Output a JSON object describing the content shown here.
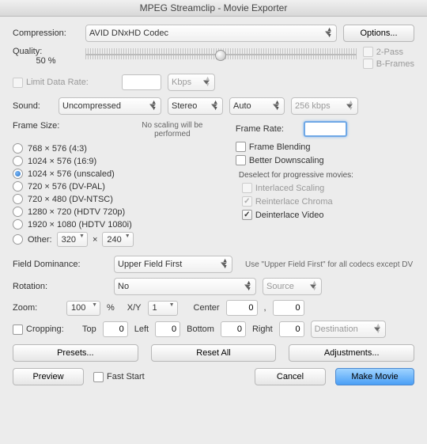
{
  "window": {
    "title": "MPEG Streamclip - Movie Exporter"
  },
  "compression": {
    "label": "Compression:",
    "value": "AVID DNxHD Codec",
    "options_button": "Options..."
  },
  "quality": {
    "label": "Quality:",
    "value_text": "50 %",
    "percent": 50,
    "two_pass": "2-Pass",
    "b_frames": "B-Frames"
  },
  "limit_data_rate": {
    "label": "Limit Data Rate:",
    "value": "",
    "unit": "Kbps"
  },
  "sound": {
    "label": "Sound:",
    "codec": "Uncompressed",
    "channels": "Stereo",
    "rate": "Auto",
    "bitrate": "256 kbps"
  },
  "frame_size": {
    "label": "Frame Size:",
    "note": "No scaling will be performed",
    "options": [
      {
        "label": "768 × 576  (4:3)",
        "checked": false
      },
      {
        "label": "1024 × 576  (16:9)",
        "checked": false
      },
      {
        "label": "1024 × 576  (unscaled)",
        "checked": true
      },
      {
        "label": "720 × 576  (DV-PAL)",
        "checked": false
      },
      {
        "label": "720 × 480  (DV-NTSC)",
        "checked": false
      },
      {
        "label": "1280 × 720  (HDTV 720p)",
        "checked": false
      },
      {
        "label": "1920 × 1080  (HDTV 1080i)",
        "checked": false
      }
    ],
    "other_label": "Other:",
    "other_w": "320",
    "other_h": "240"
  },
  "frame_rate": {
    "label": "Frame Rate:",
    "value": "",
    "frame_blending": "Frame Blending",
    "better_downscaling": "Better Downscaling",
    "deselect_note": "Deselect for progressive movies:",
    "interlaced_scaling": "Interlaced Scaling",
    "reinterlace_chroma": "Reinterlace Chroma",
    "deinterlace_video": "Deinterlace Video"
  },
  "field_dominance": {
    "label": "Field Dominance:",
    "value": "Upper Field First",
    "hint": "Use \"Upper Field First\" for all codecs except DV"
  },
  "rotation": {
    "label": "Rotation:",
    "value": "No",
    "source": "Source"
  },
  "zoom": {
    "label": "Zoom:",
    "value": "100",
    "unit": "%",
    "xy_label": "X/Y",
    "xy_value": "1",
    "center_label": "Center",
    "cx": "0",
    "cy": "0"
  },
  "cropping": {
    "label": "Cropping:",
    "top_label": "Top",
    "top": "0",
    "left_label": "Left",
    "left": "0",
    "bottom_label": "Bottom",
    "bottom": "0",
    "right_label": "Right",
    "right": "0",
    "dest": "Destination"
  },
  "buttons": {
    "presets": "Presets...",
    "reset": "Reset All",
    "adjustments": "Adjustments...",
    "preview": "Preview",
    "fast_start": "Fast Start",
    "cancel": "Cancel",
    "make": "Make Movie"
  }
}
